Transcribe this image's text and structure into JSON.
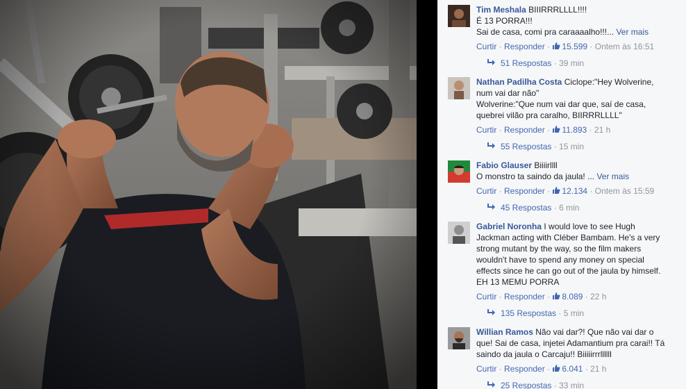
{
  "comments": [
    {
      "author": "Tim Meshala",
      "lines": [
        "BIIIRRRLLLL!!!!",
        "É 13 PORRA!!!",
        "Sai de casa, comi pra caraaaalho!!!..."
      ],
      "see_more": "Ver mais",
      "reply_label": "Curtir",
      "respond_label": "Responder",
      "likes": "15.599",
      "time": "Ontem às 16:51",
      "replies": "51 Respostas",
      "replies_time": "39 min"
    },
    {
      "author": "Nathan Padilha Costa",
      "lines": [
        "Ciclope:\"Hey Wolverine,",
        "num vai dar não\"",
        "Wolverine:\"Que num vai dar que, saí de casa,",
        "quebrei vilão pra caralho, BIIRRRLLLL\""
      ],
      "reply_label": "Curtir",
      "respond_label": "Responder",
      "likes": "11.893",
      "time": "21 h",
      "replies": "55 Respostas",
      "replies_time": "15 min"
    },
    {
      "author": "Fabio Glauser",
      "lines": [
        "Biiiirllll",
        "O monstro ta saindo da jaula! ..."
      ],
      "see_more": "Ver mais",
      "reply_label": "Curtir",
      "respond_label": "Responder",
      "likes": "12.134",
      "time": "Ontem às 15:59",
      "replies": "45 Respostas",
      "replies_time": "6 min"
    },
    {
      "author": "Gabriel Noronha",
      "lines": [
        "I would love to see Hugh",
        "Jackman acting with Cléber Bambam. He's a very",
        "strong mutant by the way, so the film makers",
        "wouldn't have to spend any money on special",
        "effects since he can go out of the jaula by himself.",
        "EH 13 MEMU PORRA"
      ],
      "reply_label": "Curtir",
      "respond_label": "Responder",
      "likes": "8.089",
      "time": "22 h",
      "replies": "135 Respostas",
      "replies_time": "5 min"
    },
    {
      "author": "Willian Ramos",
      "lines": [
        "Não vai dar?! Que não vai dar o",
        "que! Sai de casa, injetei Adamantium pra carai!! Tá",
        "saindo da jaula o Carcaju!! Biiiiirrrllllll"
      ],
      "reply_label": "Curtir",
      "respond_label": "Responder",
      "likes": "6.041",
      "time": "21 h",
      "replies": "25 Respostas",
      "replies_time": "33 min"
    }
  ],
  "separator": " · ",
  "colors": {
    "link": "#365899",
    "action": "#4267b2",
    "meta": "#90949c",
    "panel_bg": "#f6f7f9"
  },
  "icons": {
    "like": "thumbs-up-icon",
    "replies": "reply-arrow-icon"
  }
}
